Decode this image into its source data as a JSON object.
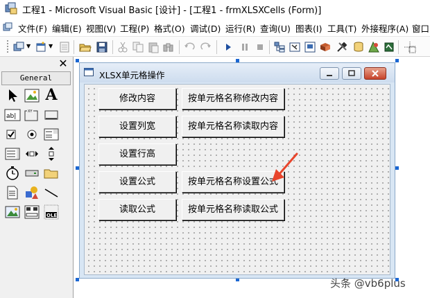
{
  "window": {
    "title": "工程1 - Microsoft Visual Basic [设计] - [工程1 - frmXLSXCells (Form)]"
  },
  "menu": {
    "items": [
      {
        "label": "文件(F)"
      },
      {
        "label": "编辑(E)"
      },
      {
        "label": "视图(V)"
      },
      {
        "label": "工程(P)"
      },
      {
        "label": "格式(O)"
      },
      {
        "label": "调试(D)"
      },
      {
        "label": "运行(R)"
      },
      {
        "label": "查询(U)"
      },
      {
        "label": "图表(I)"
      },
      {
        "label": "工具(T)"
      },
      {
        "label": "外接程序(A)"
      },
      {
        "label": "窗口"
      }
    ]
  },
  "toolbar": {
    "icons": [
      "add-project-icon",
      "add-form-icon",
      "menu-editor-icon",
      "open-icon",
      "save-icon",
      "cut-icon",
      "copy-icon",
      "paste-icon",
      "find-icon",
      "undo-icon",
      "redo-icon",
      "start-icon",
      "break-icon",
      "end-icon",
      "project-explorer-icon",
      "properties-window-icon",
      "form-layout-icon",
      "object-browser-icon",
      "toolbox-icon",
      "data-view-icon",
      "visual-component-manager-icon"
    ]
  },
  "toolbox": {
    "close_label": "✕",
    "tab_label": "General",
    "tools": [
      "pointer-icon",
      "picturebox-icon",
      "label-icon",
      "textbox-icon",
      "frame-icon",
      "commandbutton-icon",
      "checkbox-icon",
      "optionbutton-icon",
      "combobox-icon",
      "listbox-icon",
      "hscrollbar-icon",
      "vscrollbar-icon",
      "timer-icon",
      "drivelistbox-icon",
      "dirlistbox-icon",
      "filelistbox-icon",
      "shape-icon",
      "line-icon",
      "image-icon",
      "data-icon",
      "ole-icon"
    ]
  },
  "form": {
    "caption": "XLSX单元格操作",
    "buttons_left": [
      "修改内容",
      "设置列宽",
      "设置行高",
      "设置公式",
      "读取公式"
    ],
    "buttons_right": [
      "按单元格名称修改内容",
      "按单元格名称读取内容",
      "按单元格名称设置公式",
      "按单元格名称读取公式"
    ]
  },
  "watermark": {
    "text": "头条 @vb6plus"
  },
  "colors": {
    "selection_handle": "#1a66d2",
    "arrow": "#e8452c"
  }
}
